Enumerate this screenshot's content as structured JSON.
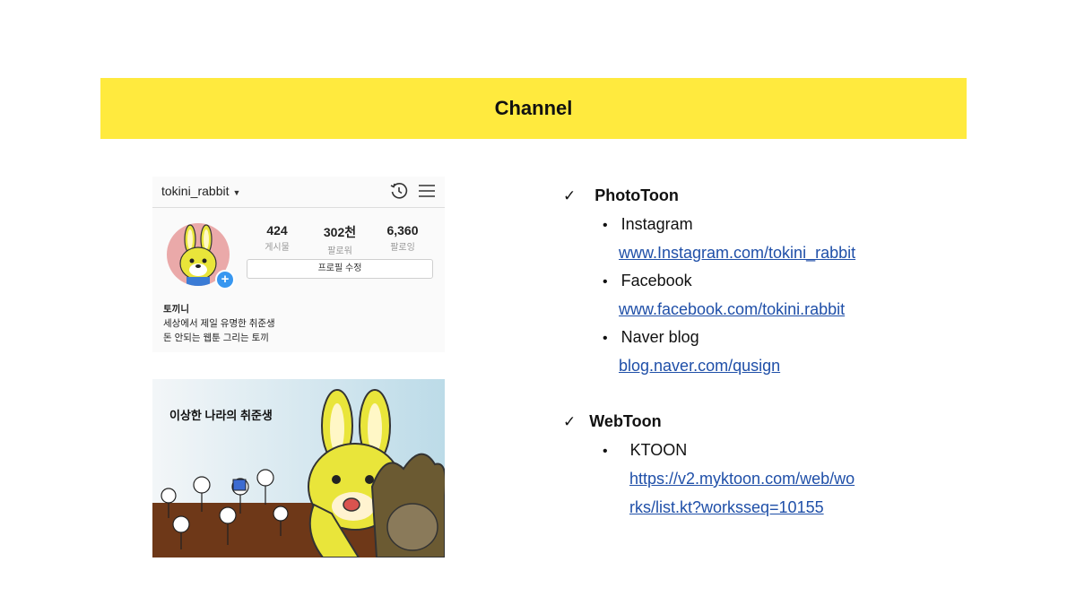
{
  "banner": {
    "title": "Channel"
  },
  "instagram": {
    "username": "tokini_rabbit",
    "icons": [
      "chevron-down-icon",
      "history-icon",
      "hamburger-menu-icon",
      "plus-icon"
    ],
    "stats": [
      {
        "value": "424",
        "label": "게시물"
      },
      {
        "value": "302천",
        "label": "팔로워"
      },
      {
        "value": "6,360",
        "label": "팔로잉"
      }
    ],
    "edit_profile_label": "프로필 수정",
    "bio": {
      "name": "토끼니",
      "line1": "세상에서 제일 유명한 취준생",
      "line2": "돈 안되는 웹툰 그리는 토끼"
    }
  },
  "comic": {
    "title": "이상한 나라의 취준생"
  },
  "channels": {
    "check_mark": "✓",
    "bullet": "•",
    "phototoon": {
      "heading": "PhotoToon",
      "items": [
        {
          "name": "Instagram",
          "url": "www.Instagram.com/tokini_rabbit"
        },
        {
          "name": "Facebook",
          "url": "www.facebook.com/tokini.rabbit"
        },
        {
          "name": "Naver blog",
          "url": "blog.naver.com/qusign"
        }
      ]
    },
    "webtoon": {
      "heading": "WebToon",
      "items": [
        {
          "name": "KTOON",
          "url_line1": "https://v2.myktoon.com/web/wo",
          "url_line2": "rks/list.kt?worksseq=10155"
        }
      ]
    }
  },
  "colors": {
    "banner": "#ffea3e",
    "link": "#1f4fa8",
    "ig_blue": "#3897f0",
    "avatar_bg": "#eaa9a9"
  }
}
